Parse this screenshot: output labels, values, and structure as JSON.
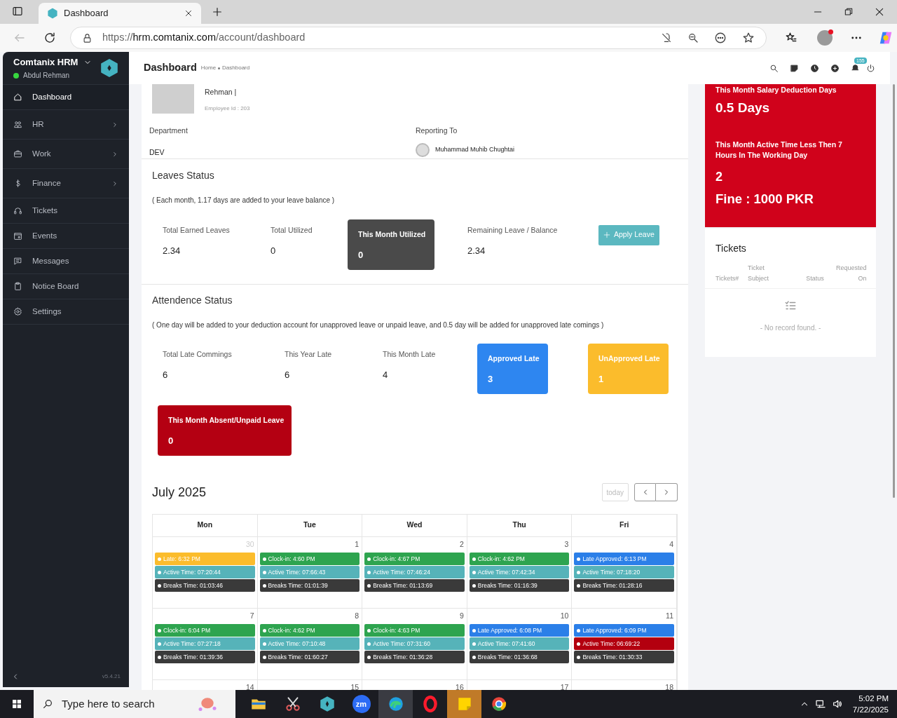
{
  "browser": {
    "tab_title": "Dashboard",
    "url_scheme": "https://",
    "url_host": "hrm.comtanix.com",
    "url_path": "/account/dashboard"
  },
  "sidebar": {
    "brand": "Comtanix HRM",
    "user": "Abdul Rehman",
    "online": true,
    "version": "v5.4.21",
    "items": [
      {
        "label": "Dashboard",
        "kind": "home",
        "selected": true,
        "submenu": false
      },
      {
        "label": "HR",
        "kind": "people",
        "selected": false,
        "submenu": true
      },
      {
        "label": "Work",
        "kind": "briefcase",
        "selected": false,
        "submenu": true
      },
      {
        "label": "Finance",
        "kind": "dollar",
        "selected": false,
        "submenu": true
      },
      {
        "label": "Tickets",
        "kind": "headset",
        "selected": false,
        "submenu": false
      },
      {
        "label": "Events",
        "kind": "calendar",
        "selected": false,
        "submenu": false
      },
      {
        "label": "Messages",
        "kind": "message",
        "selected": false,
        "submenu": false
      },
      {
        "label": "Notice Board",
        "kind": "clipboard",
        "selected": false,
        "submenu": false
      },
      {
        "label": "Settings",
        "kind": "gear",
        "selected": false,
        "submenu": false
      }
    ]
  },
  "header": {
    "title": "Dashboard",
    "breadcrumb": [
      "Home",
      "Dashboard"
    ],
    "notification_count": "155"
  },
  "profile": {
    "name": "Rehman |",
    "employee_id": "Employee Id : 203",
    "department_label": "Department",
    "department": "DEV",
    "reporting_label": "Reporting To",
    "reporting_to": "Muhammad Muhib Chughtai"
  },
  "leaves": {
    "title": "Leaves Status",
    "note": "( Each month, 1.17 days are added to your leave balance )",
    "apply_button": "Apply Leave",
    "stats": [
      {
        "kind": "plain",
        "label": "Total Earned Leaves",
        "value": "2.34"
      },
      {
        "kind": "plain",
        "label": "Total Utilized",
        "value": "0"
      },
      {
        "kind": "dark",
        "label": "This Month Utilized",
        "value": "0"
      },
      {
        "kind": "plain",
        "label": "Remaining Leave / Balance",
        "value": "2.34"
      }
    ]
  },
  "attendance": {
    "title": "Attendence Status",
    "note": "( One day will be added to your deduction account for unapproved leave or unpaid leave, and 0.5 day will be added for unapproved late comings )",
    "stats": [
      {
        "kind": "plain",
        "label": "Total Late Commings",
        "value": "6"
      },
      {
        "kind": "plain",
        "label": "This Year Late",
        "value": "6"
      },
      {
        "kind": "plain",
        "label": "This Month Late",
        "value": "4"
      },
      {
        "kind": "blue",
        "label": "Approved Late",
        "value": "3"
      },
      {
        "kind": "yellow",
        "label": "UnApproved Late",
        "value": "1"
      },
      {
        "kind": "red",
        "label": "This Month Absent/Unpaid Leave",
        "value": "0"
      }
    ]
  },
  "calendar": {
    "title": "July 2025",
    "today_button": "today",
    "weekdays": [
      "Mon",
      "Tue",
      "Wed",
      "Thu",
      "Fri"
    ],
    "weeks": [
      [
        {
          "date": "30",
          "muted": true,
          "events": [
            {
              "kind": "late",
              "text": "Late: 6:32 PM"
            },
            {
              "kind": "active",
              "text": "Active Time: 07:20:44"
            },
            {
              "kind": "breaks",
              "text": "Breaks Time: 01:03:46"
            }
          ]
        },
        {
          "date": "1",
          "muted": false,
          "events": [
            {
              "kind": "clock_in",
              "text": "Clock-in: 4:60 PM"
            },
            {
              "kind": "active",
              "text": "Active Time: 07:66:43"
            },
            {
              "kind": "breaks",
              "text": "Breaks Time: 01:01:39"
            }
          ]
        },
        {
          "date": "2",
          "muted": false,
          "events": [
            {
              "kind": "clock_in",
              "text": "Clock-in: 4:67 PM"
            },
            {
              "kind": "active",
              "text": "Active Time: 07:46:24"
            },
            {
              "kind": "breaks",
              "text": "Breaks Time: 01:13:69"
            }
          ]
        },
        {
          "date": "3",
          "muted": false,
          "events": [
            {
              "kind": "clock_in",
              "text": "Clock-in: 4:62 PM"
            },
            {
              "kind": "active",
              "text": "Active Time: 07:42:34"
            },
            {
              "kind": "breaks",
              "text": "Breaks Time: 01:16:39"
            }
          ]
        },
        {
          "date": "4",
          "muted": false,
          "events": [
            {
              "kind": "late_approved",
              "text": "Late Approved: 6:13 PM"
            },
            {
              "kind": "active",
              "text": "Active Time: 07:18:20"
            },
            {
              "kind": "breaks",
              "text": "Breaks Time: 01:28:16"
            }
          ]
        }
      ],
      [
        {
          "date": "7",
          "muted": false,
          "events": [
            {
              "kind": "clock_in",
              "text": "Clock-in: 6:04 PM"
            },
            {
              "kind": "active",
              "text": "Active Time: 07:27:18"
            },
            {
              "kind": "breaks",
              "text": "Breaks Time: 01:39:36"
            }
          ]
        },
        {
          "date": "8",
          "muted": false,
          "events": [
            {
              "kind": "clock_in",
              "text": "Clock-in: 4:62 PM"
            },
            {
              "kind": "active",
              "text": "Active Time: 07:10:48"
            },
            {
              "kind": "breaks",
              "text": "Breaks Time: 01:60:27"
            }
          ]
        },
        {
          "date": "9",
          "muted": false,
          "events": [
            {
              "kind": "clock_in",
              "text": "Clock-in: 4:63 PM"
            },
            {
              "kind": "active",
              "text": "Active Time: 07:31:60"
            },
            {
              "kind": "breaks",
              "text": "Breaks Time: 01:36:28"
            }
          ]
        },
        {
          "date": "10",
          "muted": false,
          "events": [
            {
              "kind": "late_approved",
              "text": "Late Approved: 6:08 PM"
            },
            {
              "kind": "active",
              "text": "Active Time: 07:41:60"
            },
            {
              "kind": "breaks",
              "text": "Breaks Time: 01:36:68"
            }
          ]
        },
        {
          "date": "11",
          "muted": false,
          "events": [
            {
              "kind": "late_approved",
              "text": "Late Approved: 6:09 PM"
            },
            {
              "kind": "active_low",
              "text": "Active Time: 06:69:22"
            },
            {
              "kind": "breaks",
              "text": "Breaks Time: 01:30:33"
            }
          ]
        }
      ],
      [
        {
          "date": "14",
          "muted": false
        },
        {
          "date": "15",
          "muted": false
        },
        {
          "date": "16",
          "muted": false
        },
        {
          "date": "17",
          "muted": false
        },
        {
          "date": "18",
          "muted": false
        }
      ]
    ]
  },
  "deduction": {
    "title": "This Month Salary Deduction Days",
    "value": "0.5 Days",
    "active_title": "This Month Active Time Less Then 7 Hours In The Working Day",
    "active_value": "2",
    "fine": "Fine : 1000 PKR"
  },
  "tickets": {
    "title": "Tickets",
    "columns": [
      [
        "Tickets#"
      ],
      [
        "Ticket",
        "Subject"
      ],
      [
        "Status"
      ],
      [
        "Requested",
        "On"
      ]
    ],
    "empty": "- No record found. -"
  },
  "taskbar": {
    "search_placeholder": "Type here to search",
    "time": "5:02 PM",
    "date": "7/22/2025",
    "apps": [
      {
        "kind": "folder",
        "selected": false
      },
      {
        "kind": "scissors",
        "selected": false
      },
      {
        "kind": "hexagon",
        "selected": false
      },
      {
        "kind": "zoom",
        "label": "zm",
        "selected": false
      },
      {
        "kind": "edge",
        "selected": true
      },
      {
        "kind": "opera",
        "selected": false
      },
      {
        "kind": "note",
        "selected": false
      },
      {
        "kind": "chrome",
        "selected": false
      }
    ]
  }
}
